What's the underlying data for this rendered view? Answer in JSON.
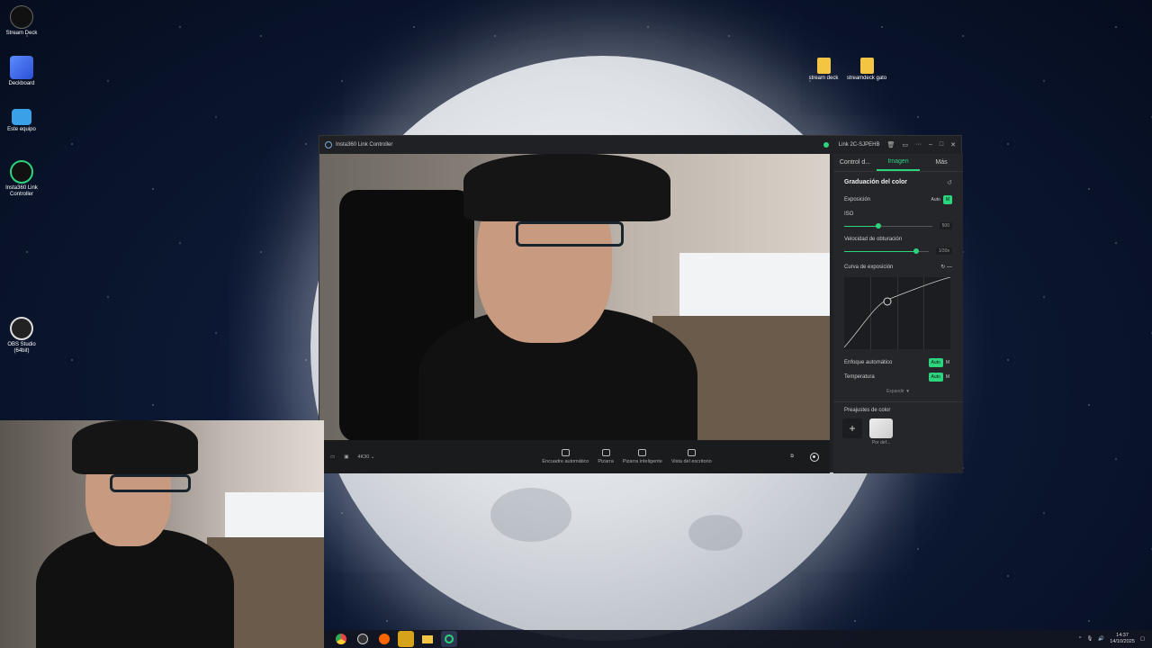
{
  "desktop": {
    "icons": [
      {
        "label": "Stream Deck"
      },
      {
        "label": "Deckboard"
      },
      {
        "label": "Este equipo"
      },
      {
        "label": "Insta360 Link Controller"
      },
      {
        "label": "OBS Studio (64bit)"
      }
    ],
    "folders": [
      {
        "label": "stream deck"
      },
      {
        "label": "streamdeck gato"
      }
    ]
  },
  "window": {
    "title": "Insta360 Link Controller",
    "device_name": "Link 2C-SJPEHB",
    "bottombar": {
      "resolution": "4K30",
      "modes": [
        {
          "label": "Encuadre automático"
        },
        {
          "label": "Pizarra"
        },
        {
          "label": "Pizarra inteligente"
        },
        {
          "label": "Vista del escritorio"
        }
      ]
    },
    "panel": {
      "tabs": [
        {
          "label": "Control d..."
        },
        {
          "label": "Imagen"
        },
        {
          "label": "Más"
        }
      ],
      "section_title": "Graduación del color",
      "exposure_label": "Exposición",
      "auto_label": "Auto",
      "manual_label": "M",
      "iso_label": "ISO",
      "iso_value": "500",
      "iso_level": 0.38,
      "shutter_label": "Velocidad de obturación",
      "shutter_value": "1/30s",
      "shutter_level": 0.8,
      "curve_label": "Curva de exposición",
      "autofocus_label": "Enfoque automático",
      "temperature_label": "Temperatura",
      "expand_label": "Expandir ▼",
      "presets_label": "Preajustes de color",
      "preset_name": "Por def..."
    }
  },
  "taskbar": {
    "time": "14:37",
    "date": "14/10/2025"
  },
  "colors": {
    "accent": "#2bd47d",
    "window_bg": "#202124",
    "panel_bg": "#25262a"
  }
}
